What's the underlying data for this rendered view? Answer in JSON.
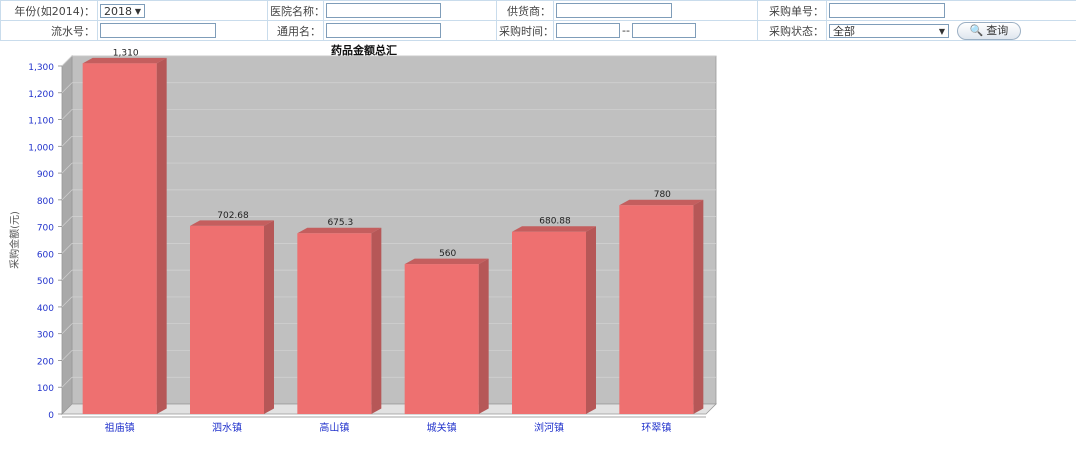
{
  "filters": {
    "year_label": "年份(如2014)：",
    "year_value": "2018",
    "hospital_label": "医院名称：",
    "hospital_value": "",
    "supplier_label": "供货商：",
    "supplier_value": "",
    "purchase_no_label": "采购单号：",
    "purchase_no_value": "",
    "serial_label": "流水号：",
    "serial_value": "",
    "generic_label": "通用名：",
    "generic_value": "",
    "time_label": "采购时间：",
    "time_start": "",
    "time_sep": "--",
    "time_end": "",
    "status_label": "采购状态：",
    "status_value": "全部",
    "search_label": "查询"
  },
  "colors": {
    "bar_front": "#ee7070",
    "bar_side": "#b65757",
    "bar_top": "#c45e5e",
    "plot_bg": "#c0c0c0",
    "axis_text": "#2233cc"
  },
  "chart_data": {
    "type": "bar",
    "title": "药品金额总汇",
    "ylabel": "采购金额(元)",
    "xlabel": "",
    "categories": [
      "祖庙镇",
      "泗水镇",
      "高山镇",
      "城关镇",
      "浏河镇",
      "环翠镇"
    ],
    "values": [
      1310,
      702.68,
      675.3,
      560,
      680.88,
      780
    ],
    "value_labels": [
      "1,310",
      "702.68",
      "675.3",
      "560",
      "680.88",
      "780"
    ],
    "ylim": [
      0,
      1300
    ],
    "yticks": [
      0,
      100,
      200,
      300,
      400,
      500,
      600,
      700,
      800,
      900,
      1000,
      1100,
      1200,
      1300
    ],
    "ytick_labels": [
      "0",
      "100",
      "200",
      "300",
      "400",
      "500",
      "600",
      "700",
      "800",
      "900",
      "1,000",
      "1,100",
      "1,200",
      "1,300"
    ],
    "grid": true,
    "legend": "none"
  }
}
